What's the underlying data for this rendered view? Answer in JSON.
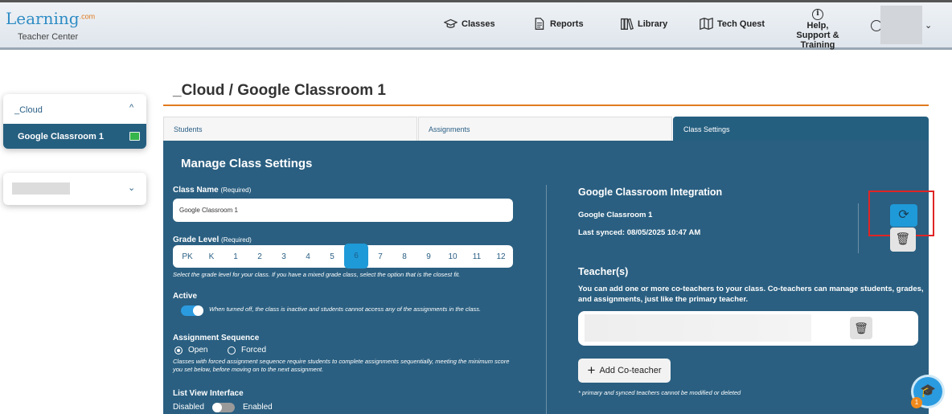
{
  "header": {
    "logo_text": "Learning",
    "logo_sup": ".com",
    "logo_sub": "Teacher Center",
    "nav": {
      "classes": "Classes",
      "reports": "Reports",
      "library": "Library",
      "tech_quest": "Tech Quest",
      "help_line1": "Help,",
      "help_line2": "Support &",
      "help_line3": "Training"
    },
    "help_icon": "i"
  },
  "sidebar": {
    "group_label": "_Cloud",
    "group_caret": "^",
    "active_item": "Google Classroom 1",
    "second_chevron": "⌄"
  },
  "page": {
    "title": "_Cloud / Google Classroom 1",
    "tabs": [
      "Students",
      "Assignments",
      "Class Settings"
    ]
  },
  "settings": {
    "heading": "Manage Class Settings",
    "class_name_label": "Class Name",
    "required_tag": "(Required)",
    "class_name_value": "Google Classroom 1",
    "grade_label": "Grade Level",
    "grades": [
      "PK",
      "K",
      "1",
      "2",
      "3",
      "4",
      "5",
      "6",
      "7",
      "8",
      "9",
      "10",
      "11",
      "12"
    ],
    "selected_grade": "6",
    "grade_note": "Select the grade level for your class. If you have a mixed grade class, select the option that is the closest fit.",
    "active_label": "Active",
    "active_on": true,
    "active_note": "When turned off, the class is inactive and students cannot access any of the assignments in the class.",
    "sequence_label": "Assignment Sequence",
    "sequence_options": [
      "Open",
      "Forced"
    ],
    "sequence_selected": "Open",
    "sequence_note": "Classes with forced assignment sequence require students to complete assignments sequentially, meeting the minimum score you set below, before moving on to the next assignment.",
    "list_view_label": "List View Interface",
    "list_view_off": "Disabled",
    "list_view_on": "Enabled",
    "list_view_enabled": false
  },
  "integration": {
    "heading": "Google Classroom Integration",
    "class_name": "Google Classroom 1",
    "last_synced": "Last synced: 08/05/2025 10:47 AM"
  },
  "teachers": {
    "heading": "Teacher(s)",
    "description": "You can add one or more co-teachers to your class. Co-teachers can manage students, grades, and assignments, just like the primary teacher.",
    "add_button": "Add Co-teacher",
    "footnote": "* primary and synced teachers cannot be modified or deleted"
  },
  "fab": {
    "badge": "1"
  }
}
